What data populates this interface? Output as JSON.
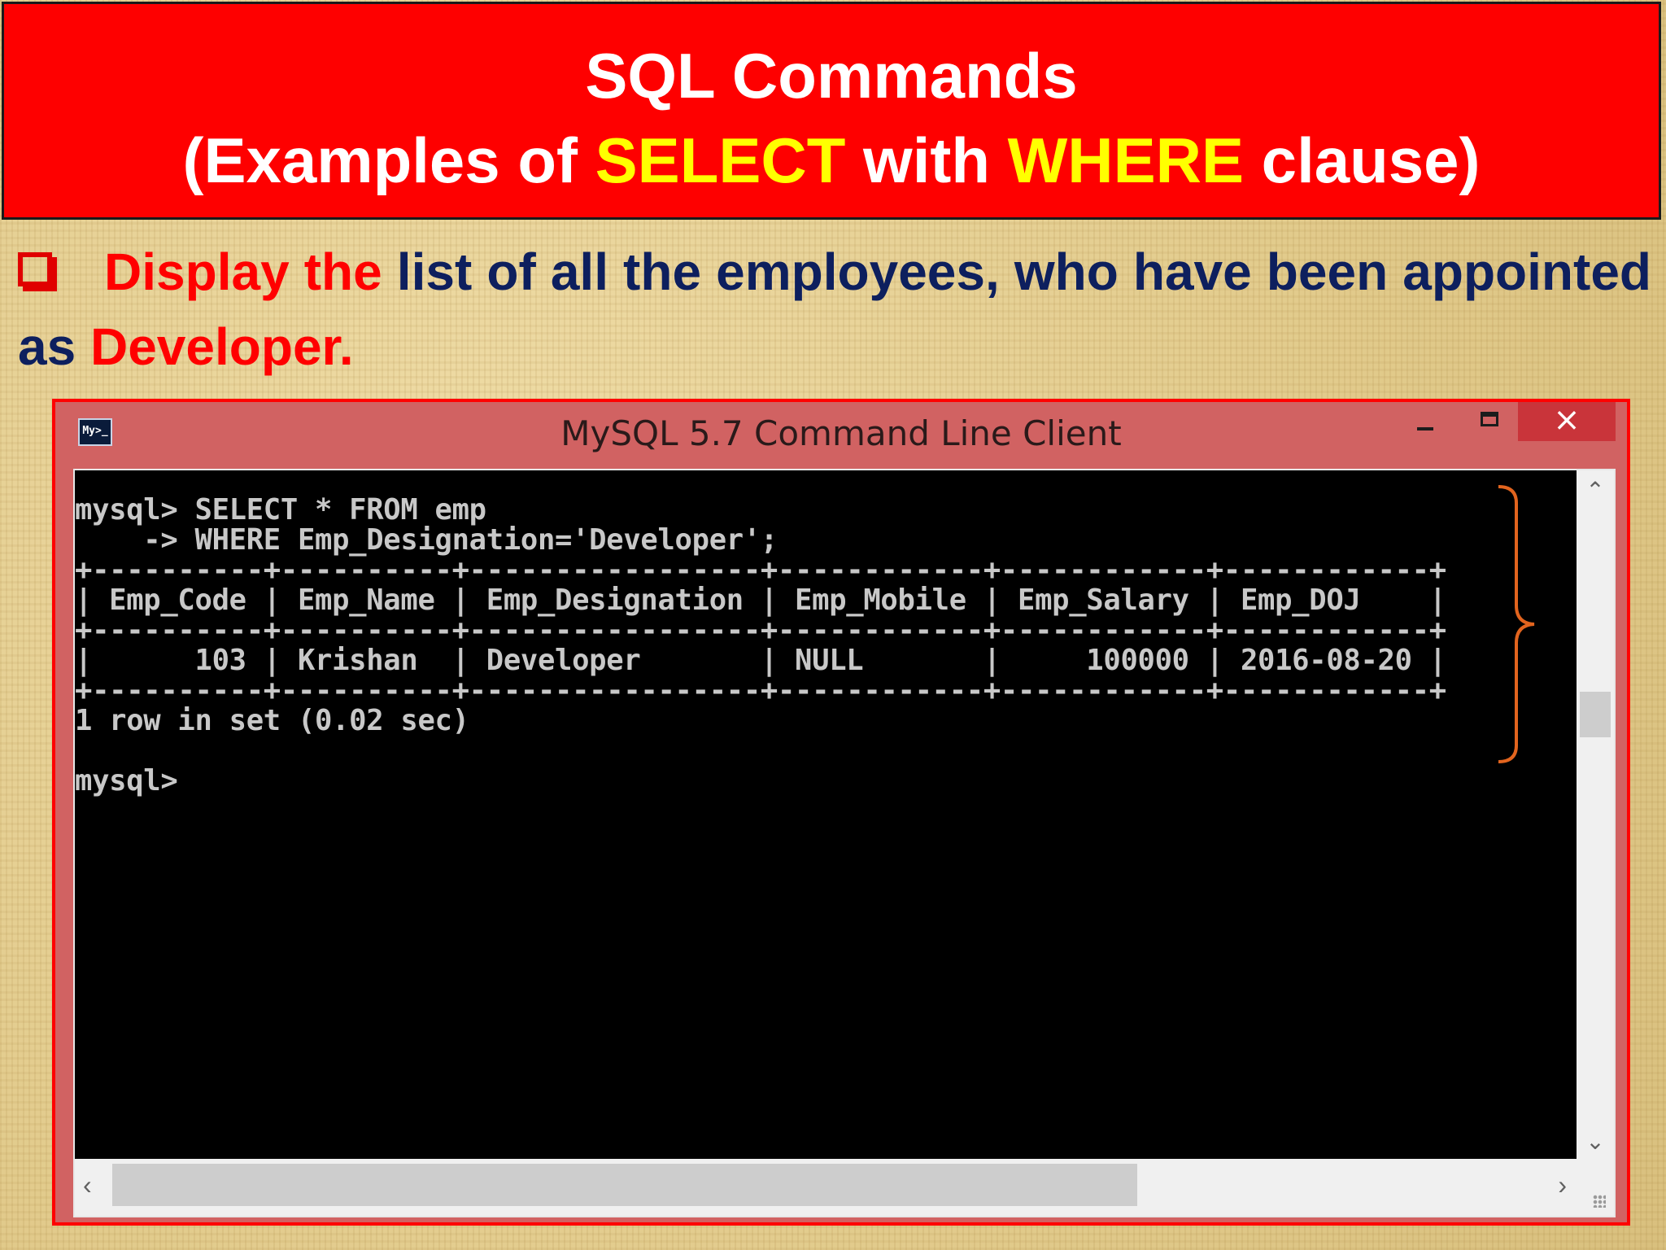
{
  "slide": {
    "title_line1": "SQL Commands",
    "title_line2_part1": "(Examples of ",
    "title_line2_select": "SELECT",
    "title_line2_part2": " with ",
    "title_line2_where": "WHERE",
    "title_line2_part3": " clause)",
    "intro_red1": "Display the",
    "intro_text": " list of all the employees, who have been appointed as ",
    "intro_red2": "Developer."
  },
  "window": {
    "title": "MySQL 5.7 Command Line Client",
    "icon_text": "My>_",
    "close_label": "×"
  },
  "console": {
    "lines": [
      "mysql> SELECT * FROM emp",
      "    -> WHERE Emp_Designation='Developer';",
      "+----------+----------+-----------------+------------+------------+------------+",
      "| Emp_Code | Emp_Name | Emp_Designation | Emp_Mobile | Emp_Salary | Emp_DOJ    |",
      "+----------+----------+-----------------+------------+------------+------------+",
      "|      103 | Krishan  | Developer       | NULL       |     100000 | 2016-08-20 |",
      "+----------+----------+-----------------+------------+------------+------------+",
      "1 row in set (0.02 sec)",
      "",
      "mysql>"
    ]
  },
  "scrollbars": {
    "up": "⌃",
    "down": "⌄",
    "left": "‹",
    "right": "›"
  },
  "colors": {
    "banner": "#fe0000",
    "highlight": "#ffff00",
    "window_frame": "#d16262",
    "brace": "#e2641e"
  }
}
